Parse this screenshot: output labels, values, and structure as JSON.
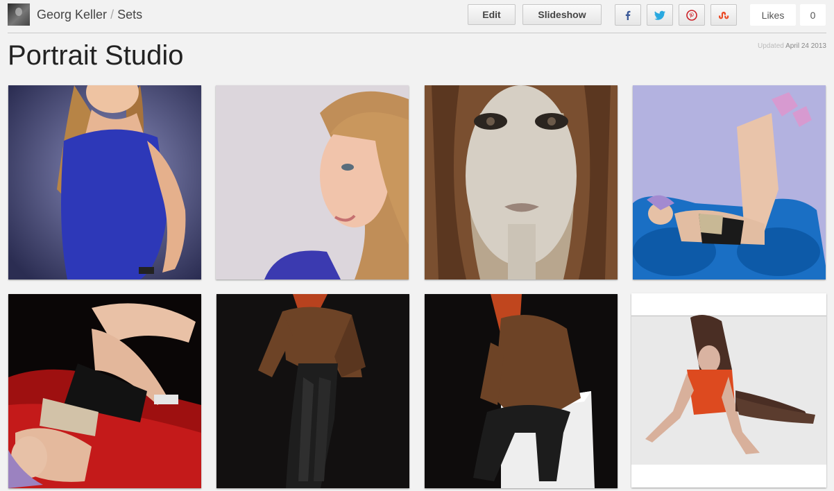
{
  "header": {
    "user_name": "Georg Keller",
    "separator": "/",
    "section": "Sets",
    "edit_label": "Edit",
    "slideshow_label": "Slideshow",
    "share": [
      {
        "name": "facebook-icon",
        "glyph": "f",
        "color": "#3b5998"
      },
      {
        "name": "twitter-icon",
        "glyph": "t",
        "color": "#2aa9e0"
      },
      {
        "name": "pinterest-icon",
        "glyph": "p",
        "color": "#cb2027"
      },
      {
        "name": "stumbleupon-icon",
        "glyph": "su",
        "color": "#eb4924"
      }
    ],
    "likes_label": "Likes",
    "likes_count": "0"
  },
  "page": {
    "title": "Portrait Studio",
    "updated_prefix": "Updated",
    "updated_date": "April 24 2013"
  },
  "photos": [
    {
      "name": "photo-blue-top-portrait"
    },
    {
      "name": "photo-profile-portrait"
    },
    {
      "name": "photo-face-closeup"
    },
    {
      "name": "photo-blue-chair"
    },
    {
      "name": "photo-rose-petals"
    },
    {
      "name": "photo-leather-pants-standing"
    },
    {
      "name": "photo-leather-pants-sitting"
    },
    {
      "name": "photo-floor-pose"
    }
  ]
}
